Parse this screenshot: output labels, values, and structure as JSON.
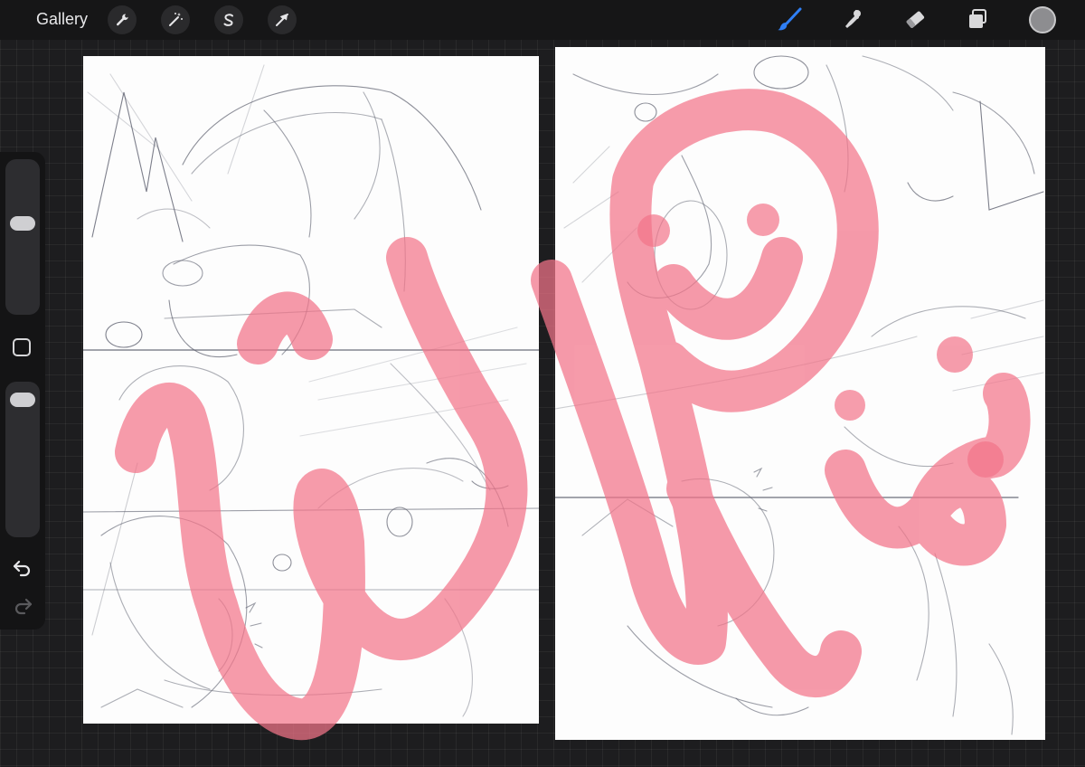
{
  "topbar": {
    "gallery_label": "Gallery",
    "left_tools": [
      {
        "name": "wrench-icon",
        "role": "actions"
      },
      {
        "name": "magic-wand-icon",
        "role": "adjustments"
      },
      {
        "name": "selection-s-icon",
        "role": "selection"
      },
      {
        "name": "arrow-cursor-icon",
        "role": "transform"
      }
    ],
    "right_tools": [
      {
        "name": "brush-icon",
        "active": true
      },
      {
        "name": "smudge-icon",
        "active": false
      },
      {
        "name": "eraser-icon",
        "active": false
      },
      {
        "name": "layers-icon",
        "active": false
      }
    ],
    "current_color": "#8d8d90",
    "active_tool_color": "#2f7ff5"
  },
  "sidebar": {
    "brush_size_level": 0.6,
    "opacity_level": 0.95,
    "icons": [
      "modify-square-icon",
      "undo-icon",
      "redo-icon"
    ]
  },
  "canvas": {
    "stroke_color": "#f27489",
    "sketch_color": "#5c5f6e"
  }
}
